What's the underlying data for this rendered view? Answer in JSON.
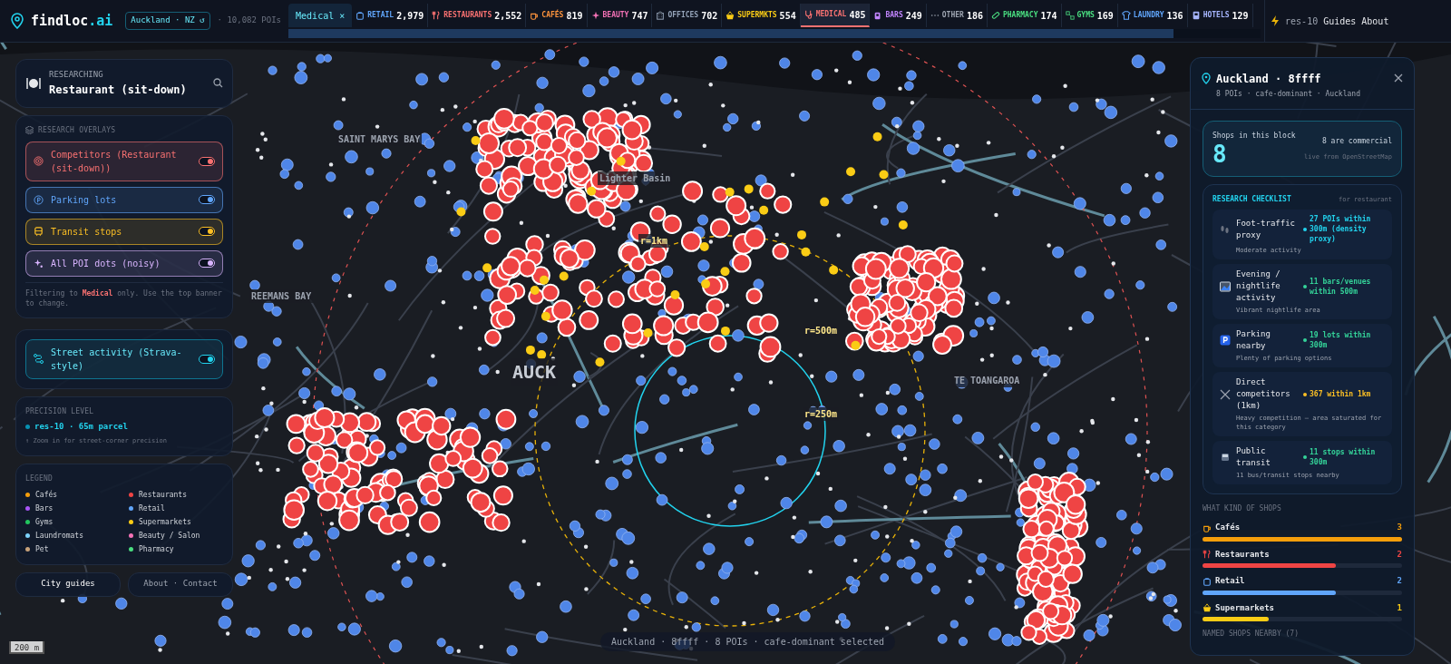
{
  "header": {
    "logo": {
      "name": "findloc",
      "suffix": ".ai"
    },
    "city": "Auckland · NZ ↺",
    "poi_total": "· 10,082 POIs",
    "filter_chip": "Medical ×",
    "tabs": [
      {
        "kind": "retail",
        "label": "RETAIL",
        "count": "2,979",
        "color": "#60a5fa",
        "selected": false
      },
      {
        "kind": "restaurants",
        "label": "RESTAURANTS",
        "count": "2,552",
        "color": "#f87171",
        "selected": false
      },
      {
        "kind": "cafes",
        "label": "CAFÉS",
        "count": "819",
        "color": "#fb923c",
        "selected": false
      },
      {
        "kind": "beauty",
        "label": "BEAUTY",
        "count": "747",
        "color": "#f472b6",
        "selected": false
      },
      {
        "kind": "offices",
        "label": "OFFICES",
        "count": "702",
        "color": "#94a3b8",
        "selected": false
      },
      {
        "kind": "supermarkets",
        "label": "SUPERMKTS",
        "count": "554",
        "color": "#facc15",
        "selected": false
      },
      {
        "kind": "medical",
        "label": "MEDICAL",
        "count": "485",
        "color": "#f87171",
        "selected": true
      },
      {
        "kind": "bars",
        "label": "BARS",
        "count": "249",
        "color": "#c084fc",
        "selected": false
      },
      {
        "kind": "other",
        "label": "OTHER",
        "count": "186",
        "color": "#9ca3af",
        "selected": false
      },
      {
        "kind": "pharmacy",
        "label": "PHARMACY",
        "count": "174",
        "color": "#4ade80",
        "selected": false
      },
      {
        "kind": "gyms",
        "label": "GYMS",
        "count": "169",
        "color": "#4ade80",
        "selected": false
      },
      {
        "kind": "laundry",
        "label": "LAUNDRY",
        "count": "136",
        "color": "#60a5fa",
        "selected": false
      },
      {
        "kind": "hotels",
        "label": "HOTELS",
        "count": "129",
        "color": "#a5b4fc",
        "selected": false
      }
    ],
    "links": [
      "res-10",
      "Guides",
      "About"
    ]
  },
  "researching": {
    "caption": "RESEARCHING",
    "title": "Restaurant (sit-down)"
  },
  "overlays": {
    "heading": "RESEARCH OVERLAYS",
    "items": [
      {
        "kind": "target",
        "label": "Competitors (Restaurant (sit-down))",
        "color": "#f87171",
        "on": true
      },
      {
        "kind": "parking",
        "label": "Parking lots",
        "color": "#60a5fa",
        "on": true
      },
      {
        "kind": "transit",
        "label": "Transit stops",
        "color": "#fbbf24",
        "on": true
      },
      {
        "kind": "sparkle",
        "label": "All POI dots (noisy)",
        "color": "#d8b4fe",
        "on": true
      }
    ],
    "note_before": "Filtering to",
    "note_highlight": "Medical",
    "note_after": "only. Use the top banner to change."
  },
  "street_activity": {
    "label": "Street activity (Strava-style)",
    "on": true
  },
  "precision": {
    "heading": "PRECISION LEVEL",
    "value": "res-10 · 65m parcel",
    "hint": "↑ Zoom in for street-corner precision"
  },
  "legend": {
    "heading": "LEGEND",
    "items": [
      {
        "label": "Cafés",
        "color": "#f59e0b"
      },
      {
        "label": "Restaurants",
        "color": "#ef4444"
      },
      {
        "label": "Bars",
        "color": "#a855f7"
      },
      {
        "label": "Retail",
        "color": "#60a5fa"
      },
      {
        "label": "Gyms",
        "color": "#22c55e"
      },
      {
        "label": "Supermarkets",
        "color": "#facc15"
      },
      {
        "label": "Laundromats",
        "color": "#7dd3fc"
      },
      {
        "label": "Beauty / Salon",
        "color": "#f472b6"
      },
      {
        "label": "Pet",
        "color": "#c8a27a"
      },
      {
        "label": "Pharmacy",
        "color": "#4ade80"
      }
    ]
  },
  "footer_buttons": [
    "City guides",
    "About · Contact"
  ],
  "map": {
    "labels": [
      {
        "kind": "place",
        "text": "SAINT MARYS BAY"
      },
      {
        "kind": "place",
        "text": "REEMANS BAY"
      },
      {
        "kind": "place",
        "text": "Lighter Basin"
      },
      {
        "kind": "big",
        "text": "AUCK"
      },
      {
        "kind": "place",
        "text": "TE TOANGAROA"
      },
      {
        "kind": "ring",
        "text": "r=1km"
      },
      {
        "kind": "ring",
        "text": "r=500m"
      },
      {
        "kind": "ring",
        "text": "r=250m"
      }
    ],
    "scale": "200 m",
    "status": "Auckland · 8ffff · 8 POIs · cafe-dominant selected"
  },
  "detail": {
    "title": "Auckland · 8ffff",
    "subtitle": "8 POIs · cafe-dominant · Auckland",
    "shops": {
      "caption": "Shops in this block",
      "count": "8",
      "commercial": "8 are commercial",
      "source": "live from OpenStreetMap"
    },
    "checklist": {
      "heading": "RESEARCH CHECKLIST",
      "context": "for restaurant",
      "items": [
        {
          "kind": "feet",
          "title": "Foot-traffic proxy",
          "reading": "27 POIs within 300m (density proxy)",
          "note": "Moderate activity",
          "color": "#22d3ee"
        },
        {
          "kind": "night",
          "title": "Evening / nightlife activity",
          "reading": "11 bars/venues within 500m",
          "note": "Vibrant nightlife area",
          "color": "#34d399"
        },
        {
          "kind": "parking",
          "title": "Parking nearby",
          "reading": "19 lots within 300m",
          "note": "Plenty of parking options",
          "color": "#34d399"
        },
        {
          "kind": "swords",
          "title": "Direct competitors (1km)",
          "reading": "367 within 1km",
          "note": "Heavy competition — area saturated for this category",
          "color": "#fbbf24"
        },
        {
          "kind": "tram",
          "title": "Public transit",
          "reading": "11 stops within 300m",
          "note": "11 bus/transit stops nearby",
          "color": "#34d399"
        }
      ]
    },
    "kinds_heading": "WHAT KIND OF SHOPS",
    "kinds": [
      {
        "kind": "cafes",
        "label": "Cafés",
        "count": "3",
        "level": 1,
        "color": "#f59e0b"
      },
      {
        "kind": "restaurants",
        "label": "Restaurants",
        "count": "2",
        "level": 0.667,
        "color": "#ef4444"
      },
      {
        "kind": "retail",
        "label": "Retail",
        "count": "2",
        "level": 0.667,
        "color": "#60a5fa"
      },
      {
        "kind": "supermarkets",
        "label": "Supermarkets",
        "count": "1",
        "level": 0.333,
        "color": "#facc15"
      }
    ],
    "named_heading": "NAMED SHOPS NEARBY (7)"
  }
}
